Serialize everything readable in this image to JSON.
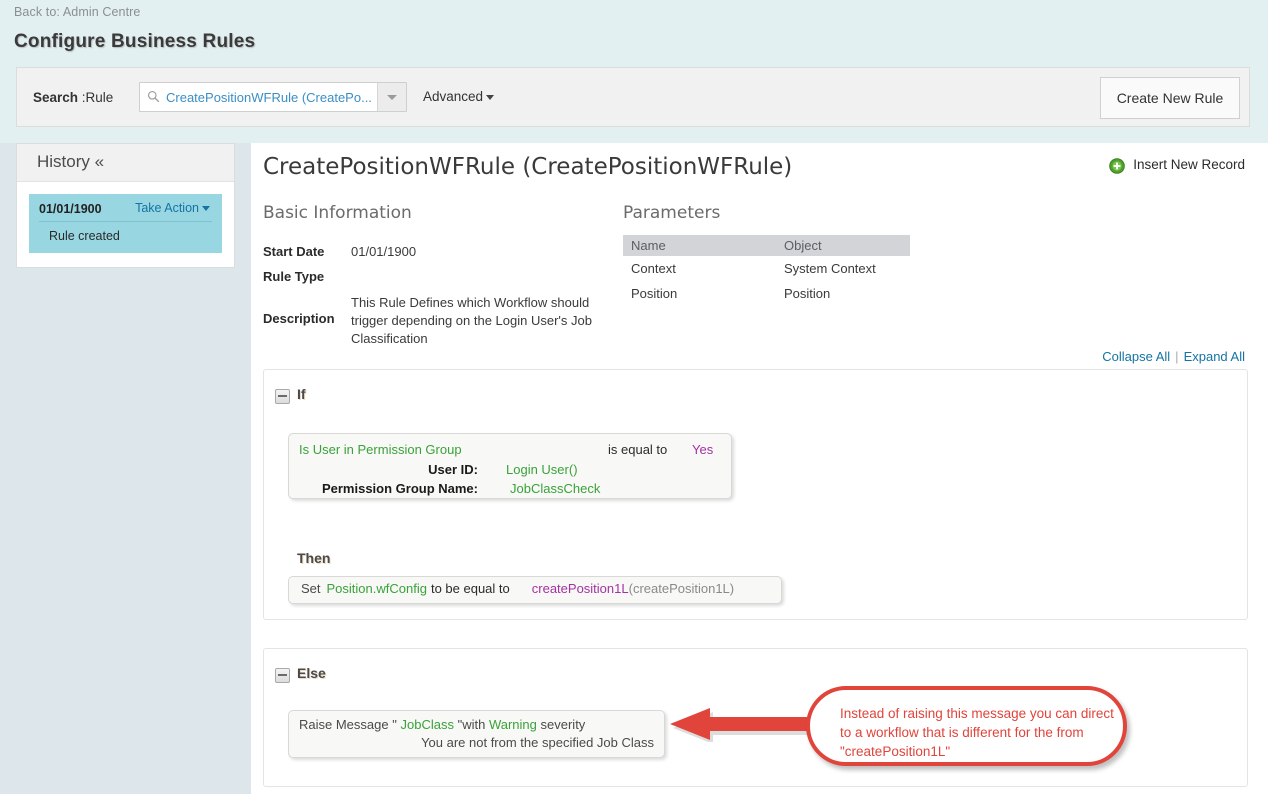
{
  "breadcrumb": "Back to: Admin Centre",
  "page_title": "Configure Business Rules",
  "search": {
    "label_bold": "Search",
    "label_rest": " :Rule",
    "value": "CreatePositionWFRule (CreatePo...",
    "icon": "search-icon",
    "dropdown_icon": "chevron-down-icon",
    "advanced_label": "Advanced",
    "create_button": "Create New Rule"
  },
  "sidebar": {
    "history_title": "History «",
    "items": [
      {
        "date": "01/01/1900",
        "action_label": "Take Action",
        "description": "Rule created"
      }
    ]
  },
  "main": {
    "rule_title": "CreatePositionWFRule (CreatePositionWFRule)",
    "insert_record": "Insert New Record",
    "basic_info_heading": "Basic Information",
    "parameters_heading": "Parameters",
    "fields": {
      "start_date_label": "Start Date",
      "start_date_value": "01/01/1900",
      "rule_type_label": "Rule Type",
      "rule_type_value": "",
      "description_label": "Description",
      "description_value": "This Rule Defines which Workflow should trigger depending on the Login User's Job Classification"
    },
    "parameters_table": {
      "headers": [
        "Name",
        "Object"
      ],
      "rows": [
        [
          "Context",
          "System Context"
        ],
        [
          "Position",
          "Position"
        ]
      ]
    },
    "collapse_all": "Collapse All",
    "expand_all": "Expand All",
    "if_panel": {
      "keyword": "If",
      "condition": {
        "function": "Is User in Permission Group",
        "operator": "is equal to",
        "value": "Yes",
        "args": [
          {
            "key": "User ID:",
            "value": "Login User()"
          },
          {
            "key": "Permission Group Name:",
            "value": "JobClassCheck"
          }
        ]
      },
      "then_keyword": "Then",
      "assignment": {
        "set_keyword": "Set",
        "field": "Position.wfConfig",
        "middle": "to be equal to",
        "value": "createPosition1L",
        "value_suffix": "(createPosition1L)"
      }
    },
    "else_panel": {
      "keyword": "Else",
      "raise": {
        "prefix": "Raise Message",
        "quote_open": "\"",
        "message_key": "JobClass",
        "quote_close": "\"",
        "with_word": "with",
        "severity": "Warning",
        "severity_word": "severity",
        "message_text": "You are not from the specified Job Class"
      }
    }
  },
  "annotation": {
    "text": "Instead of raising this message you can direct to a workflow that is different for the from \"createPosition1L\"",
    "color": "#e0443b"
  },
  "colors": {
    "page_background": "#e3f0f1",
    "sidebar_background": "#dde7eb",
    "history_highlight": "#98d7e2",
    "link": "#1474a4",
    "green": "#3aa23a",
    "purple": "#a432a4",
    "annotation_red": "#e0443b"
  }
}
